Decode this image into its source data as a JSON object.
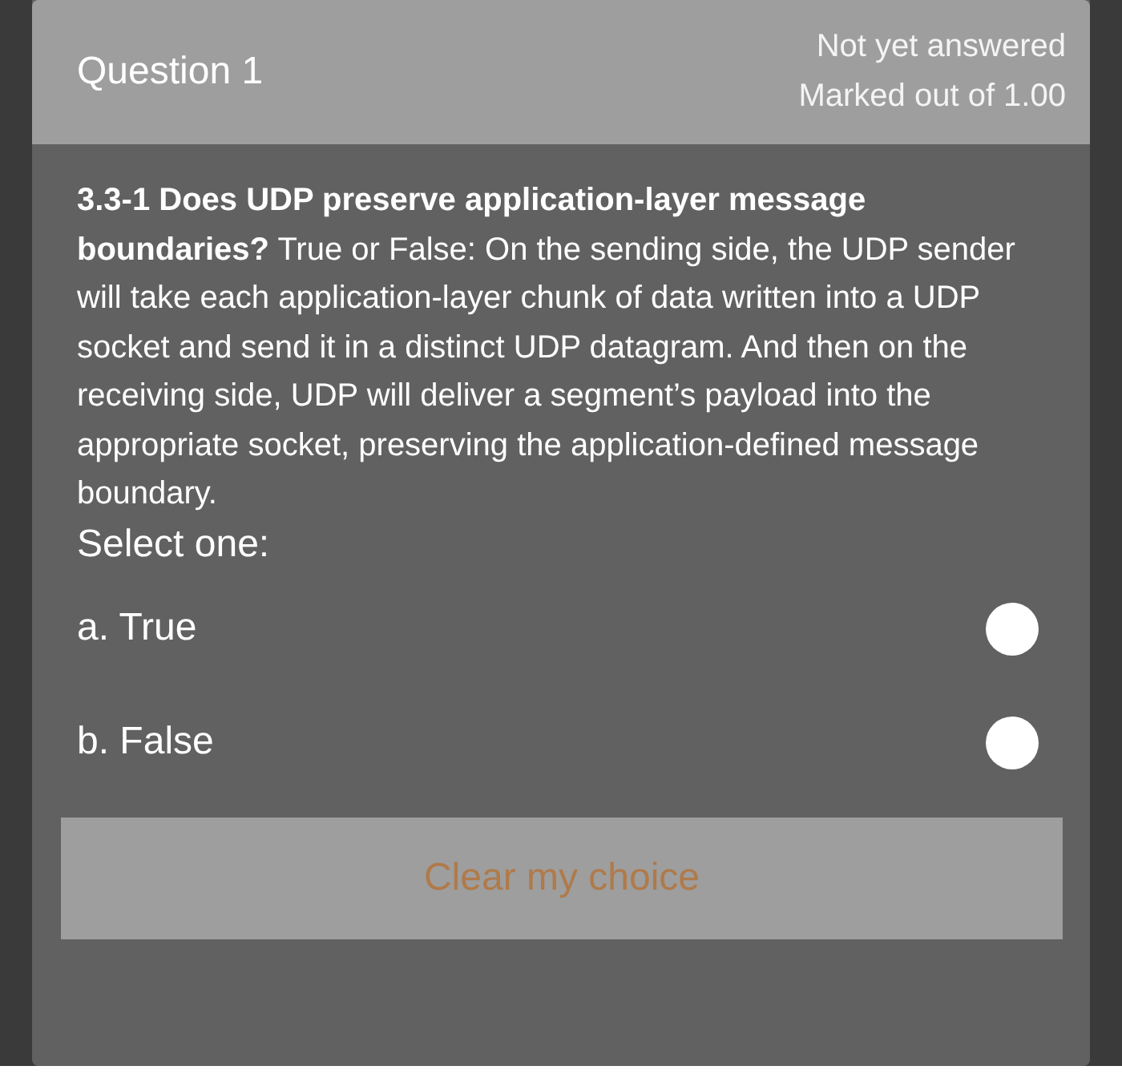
{
  "header": {
    "title": "Question 1",
    "status": "Not yet answered",
    "marks": "Marked out of 1.00"
  },
  "question": {
    "text": "**3.3-1 Does UDP preserve application-layer message boundaries?** True or False:  On the sending side, the UDP sender will take each application-layer chunk of data written into a UDP socket and send it in a distinct UDP datagram. And then on the receiving side, UDP will deliver a segment’s payload into the appropriate socket, preserving the application-defined message boundary.",
    "prompt": "Select one:"
  },
  "options": [
    {
      "label": "a. True",
      "selected": false
    },
    {
      "label": "b. False",
      "selected": false
    }
  ],
  "clear_button": "Clear my choice"
}
